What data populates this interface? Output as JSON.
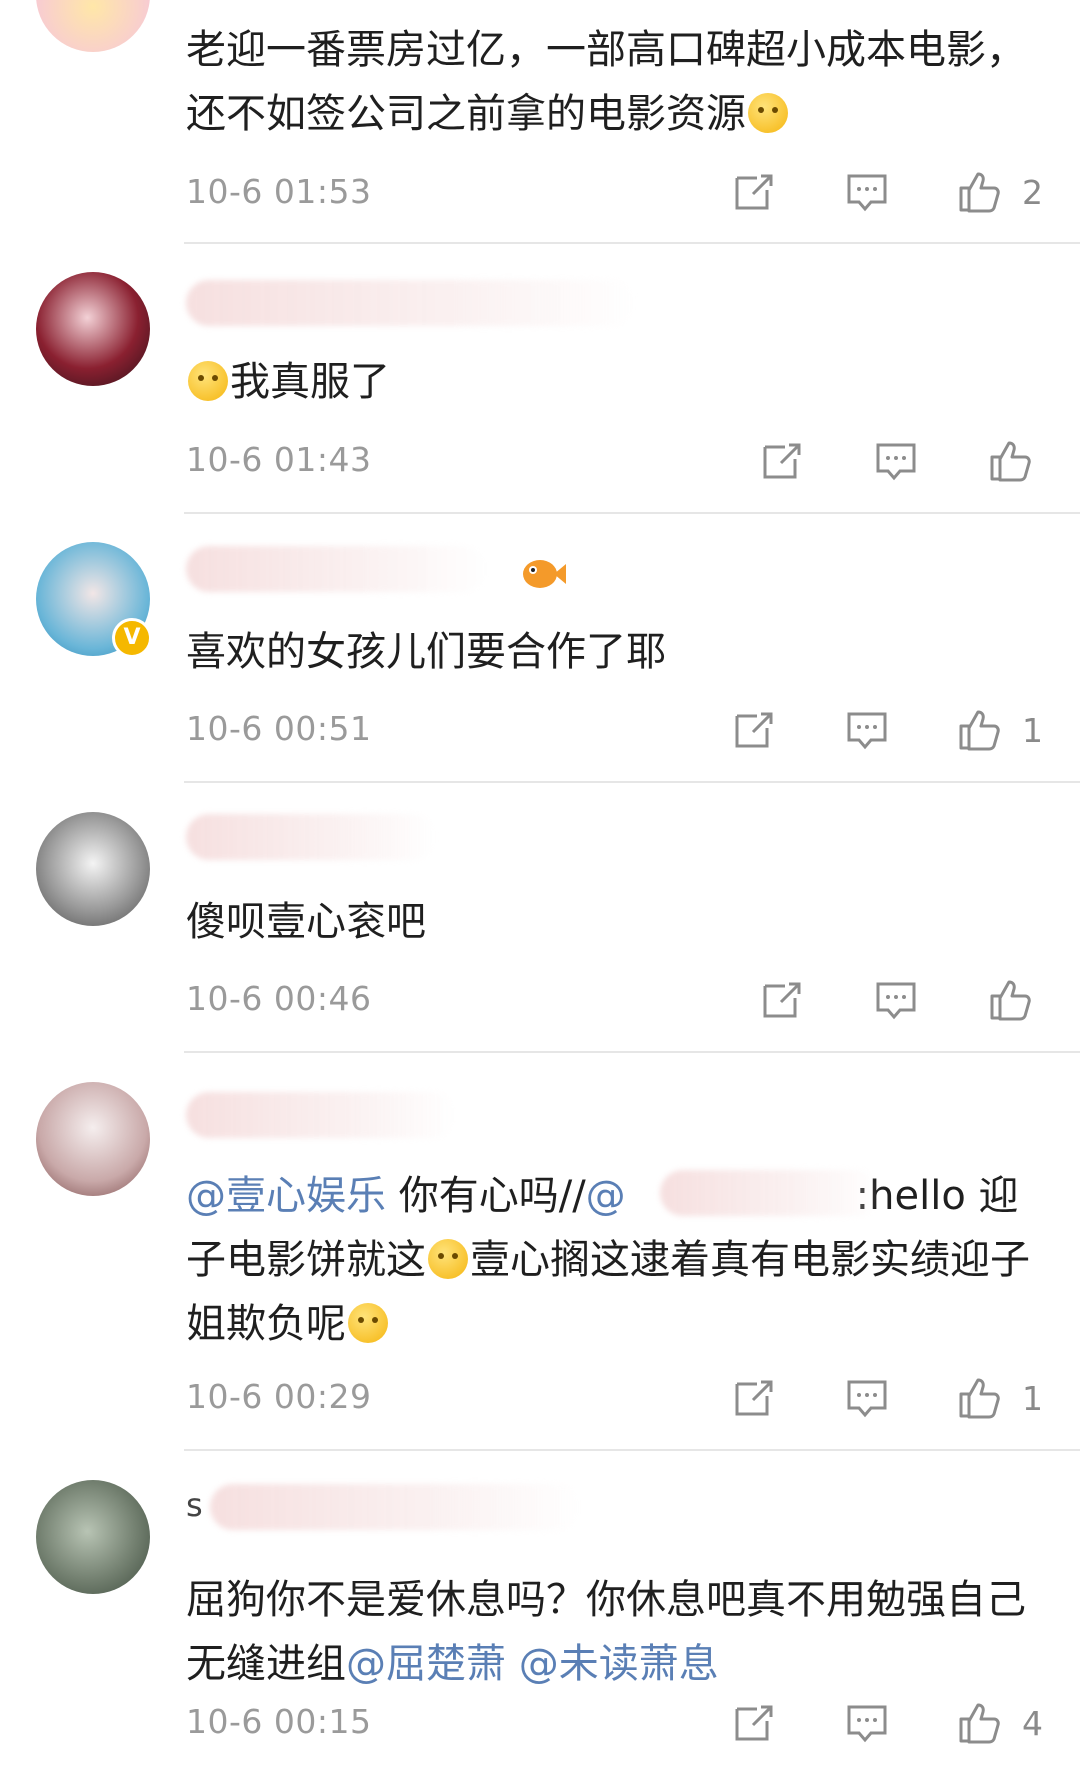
{
  "comments": [
    {
      "text": "老迎一番票房过亿，一部高口碑超小成本电影，还不如签公司之前拿的电影资源",
      "time": "10-6 01:53",
      "likes": "2"
    },
    {
      "text": "我真服了",
      "time": "10-6 01:43",
      "likes": ""
    },
    {
      "text": "喜欢的女孩儿们要合作了耶",
      "time": "10-6 00:51",
      "likes": "1"
    },
    {
      "text": "傻呗壹心衮吧",
      "time": "10-6 00:46",
      "likes": ""
    },
    {
      "mention1": "@壹心娱乐",
      "text_a": " 你有心吗//",
      "mention2": "@",
      "text_b": ":hello 迎子电影饼就这",
      "text_c": "壹心搁这逮着真有电影实绩迎子姐欺负呢",
      "time": "10-6 00:29",
      "likes": "1"
    },
    {
      "username_prefix": "s",
      "text": "屈狗你不是爱休息吗？你休息吧真不用勉强自己无缝进组",
      "mention1": "@屈楚萧",
      "mention2": "@未读萧息",
      "time": "10-6 00:15",
      "likes": "4"
    }
  ],
  "icons": {
    "share": "share-icon",
    "comment": "comment-icon",
    "like": "thumbs-up-icon"
  },
  "colors": {
    "mention": "#5a7fb5",
    "time": "#9a9a9a",
    "divider": "#e6e6e6"
  }
}
